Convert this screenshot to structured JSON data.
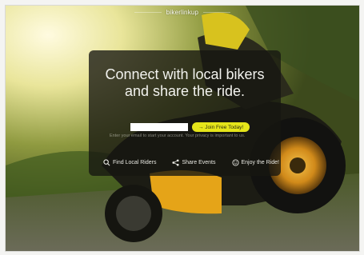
{
  "brand": {
    "name": "bikerlinkup"
  },
  "hero": {
    "headline_line1": "Connect with local bikers",
    "headline_line2": "and share the ride."
  },
  "signup": {
    "email_placeholder": "",
    "join_label": "→ Join Free Today!",
    "note": "Enter your email to start your account. Your privacy is important to us."
  },
  "features": [
    {
      "label": "Find Local Riders",
      "icon": "search-icon"
    },
    {
      "label": "Share Events",
      "icon": "share-icon"
    },
    {
      "label": "Enjoy the Ride!",
      "icon": "smiley-icon"
    }
  ],
  "colors": {
    "accent": "#e5e51a",
    "panel": "#161611",
    "headline": "#f2f2ee"
  }
}
